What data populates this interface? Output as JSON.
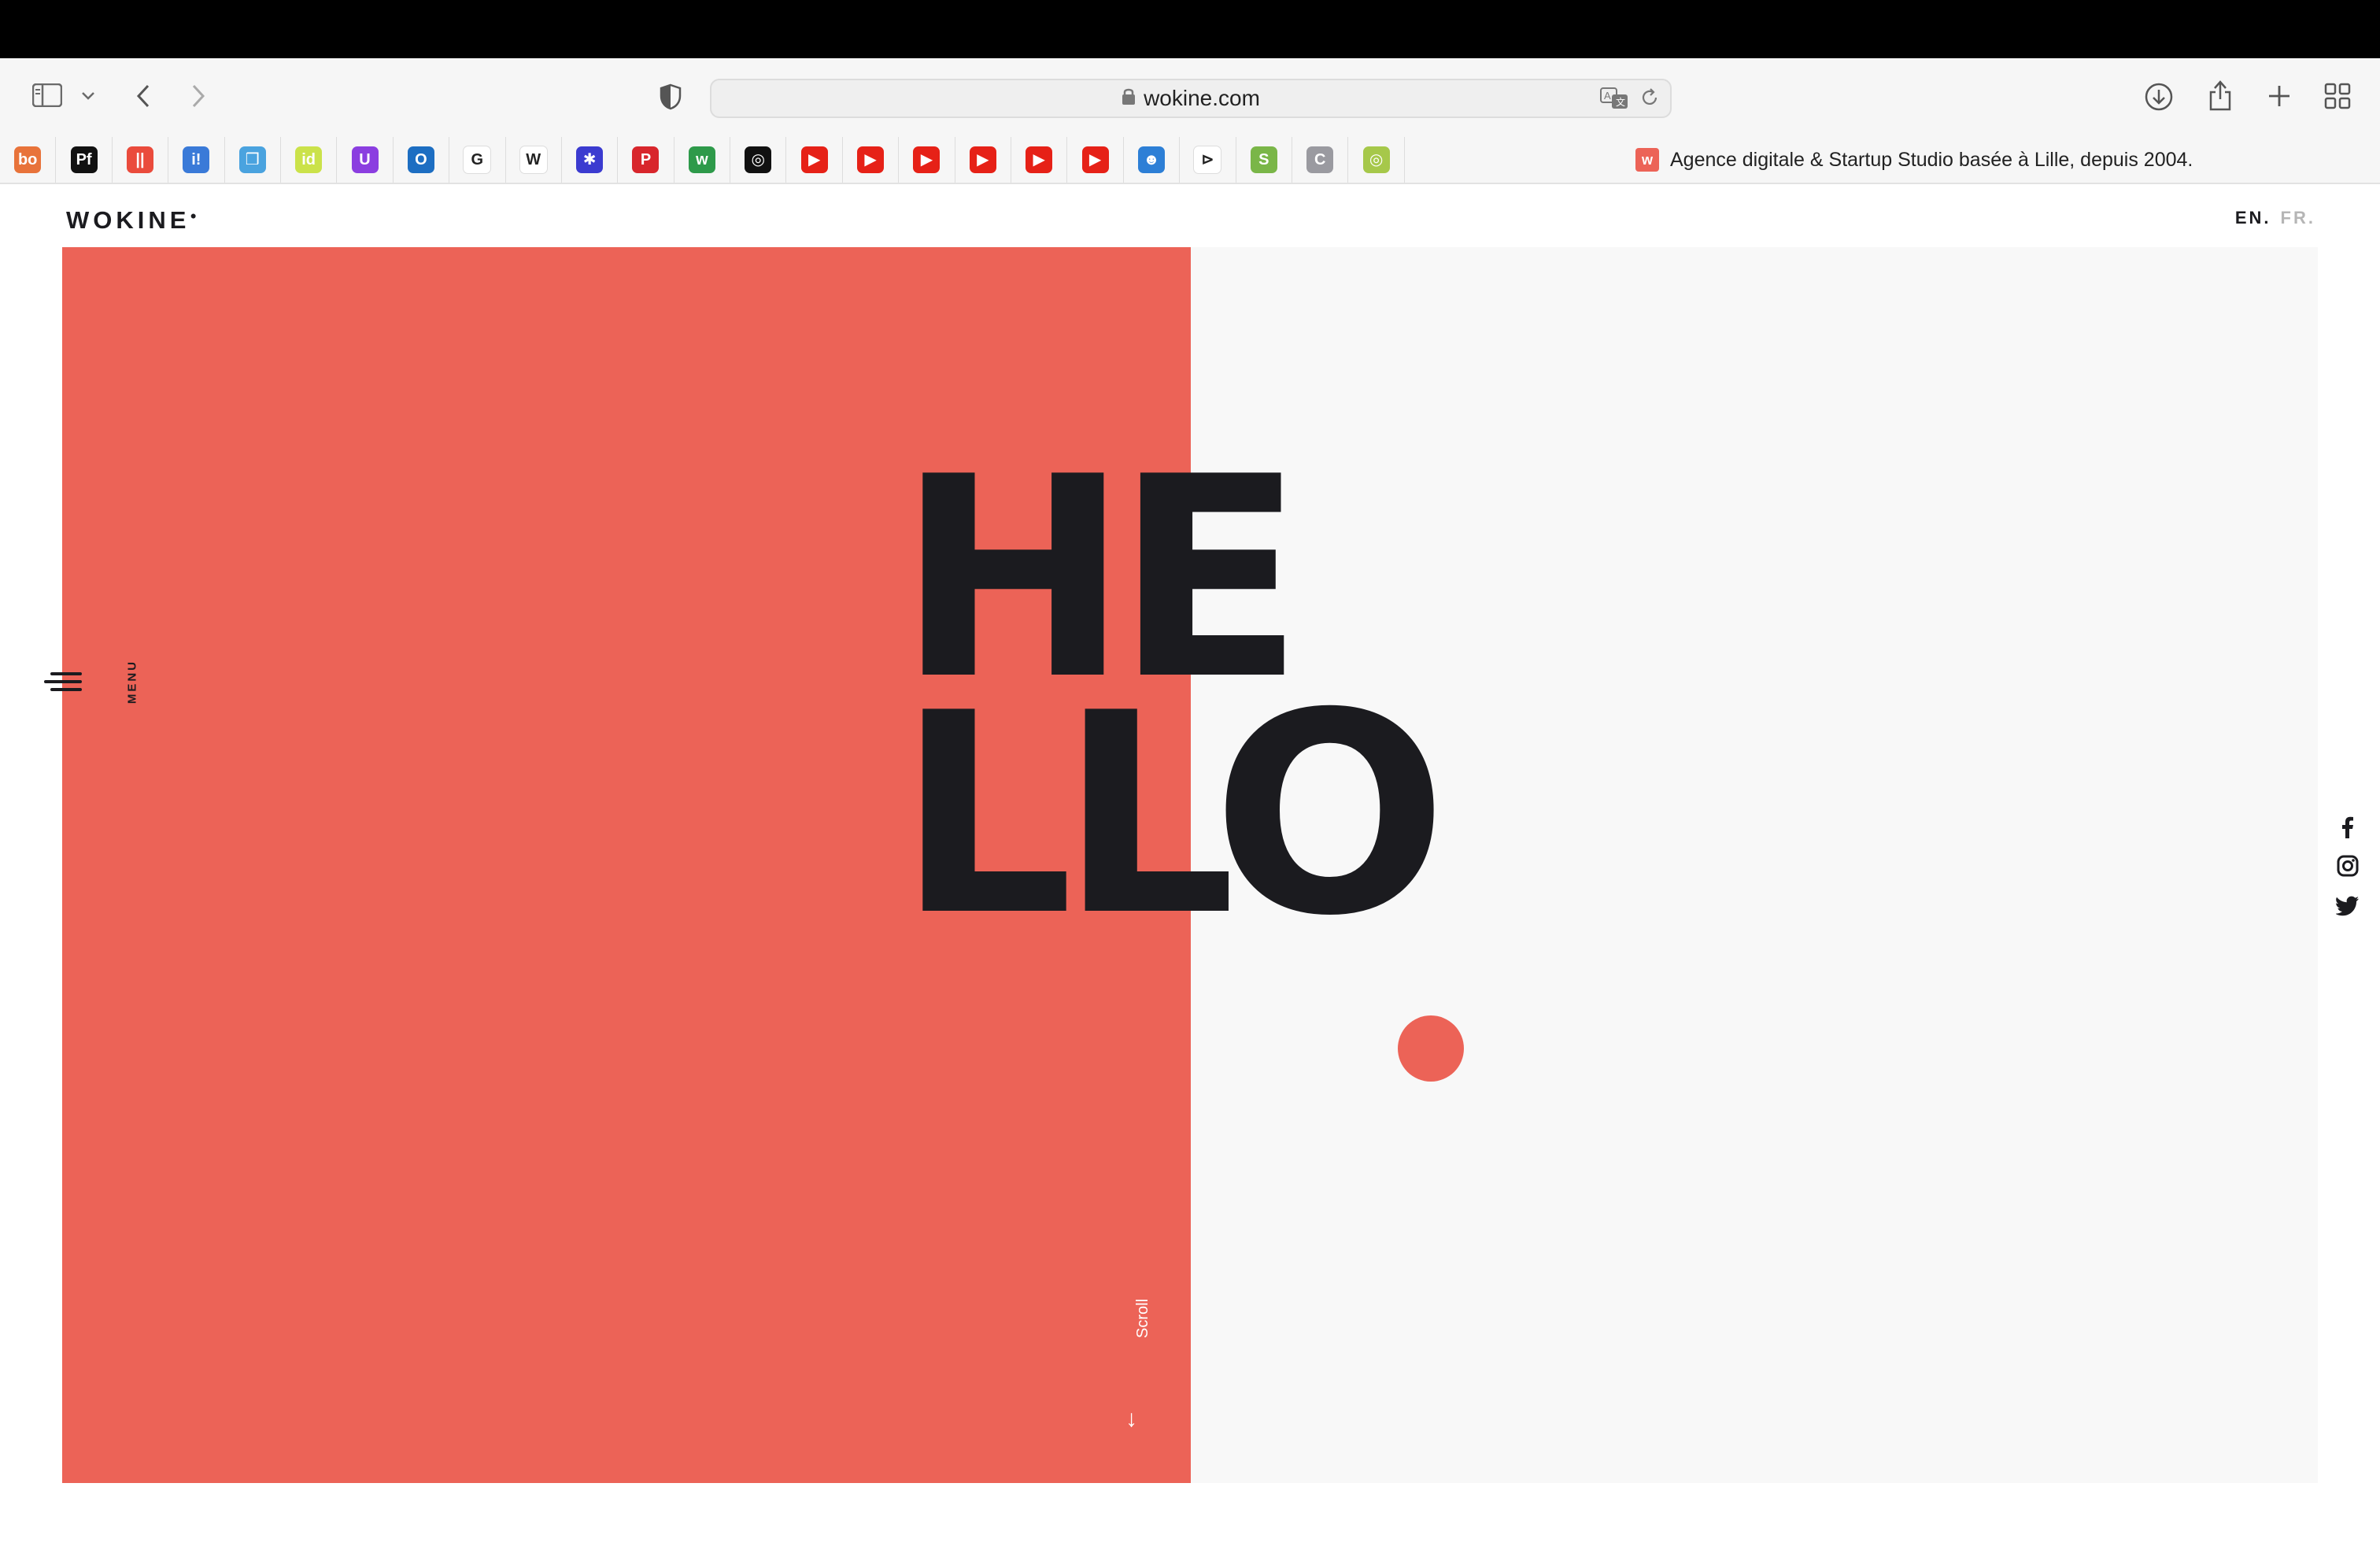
{
  "browser": {
    "url": "wokine.com",
    "tab_title": "Agence digitale & Startup Studio basée à Lille, depuis 2004.",
    "bookmarks": [
      {
        "name": "bo",
        "color": "#e8733a"
      },
      {
        "name": "Pf",
        "color": "#111111"
      },
      {
        "name": "||",
        "color": "#ea4b3c"
      },
      {
        "name": "i!",
        "color": "#3a7ad8"
      },
      {
        "name": "❒",
        "color": "#4aa3df"
      },
      {
        "name": "id",
        "color": "#cbe24a"
      },
      {
        "name": "U",
        "color": "#8b3ee0"
      },
      {
        "name": "O",
        "color": "#1d6ec2"
      },
      {
        "name": "G",
        "color": "#ffffff"
      },
      {
        "name": "W",
        "color": "#ffffff"
      },
      {
        "name": "✱",
        "color": "#3b3bd0"
      },
      {
        "name": "P",
        "color": "#d8262c"
      },
      {
        "name": "w",
        "color": "#2e9a4a"
      },
      {
        "name": "◎",
        "color": "#111111"
      },
      {
        "name": "▶",
        "color": "#e62117"
      },
      {
        "name": "▶",
        "color": "#e62117"
      },
      {
        "name": "▶",
        "color": "#e62117"
      },
      {
        "name": "▶",
        "color": "#e62117"
      },
      {
        "name": "▶",
        "color": "#e62117"
      },
      {
        "name": "▶",
        "color": "#e62117"
      },
      {
        "name": "☻",
        "color": "#2d7fd6"
      },
      {
        "name": "⊳",
        "color": "#ffffff"
      },
      {
        "name": "S",
        "color": "#7ab648"
      },
      {
        "name": "C",
        "color": "#9a9aa0"
      },
      {
        "name": "◎",
        "color": "#a6c84a"
      }
    ]
  },
  "site": {
    "logo": "WOKINE",
    "lang_en": "EN.",
    "lang_fr": "FR.",
    "menu_label": "MENU",
    "hero_line1": "HE",
    "hero_line2": "LLO",
    "scroll_label": "Scroll",
    "scroll_arrow": "↓",
    "accent_color": "#ec6357",
    "text_color": "#1b1b1f"
  }
}
